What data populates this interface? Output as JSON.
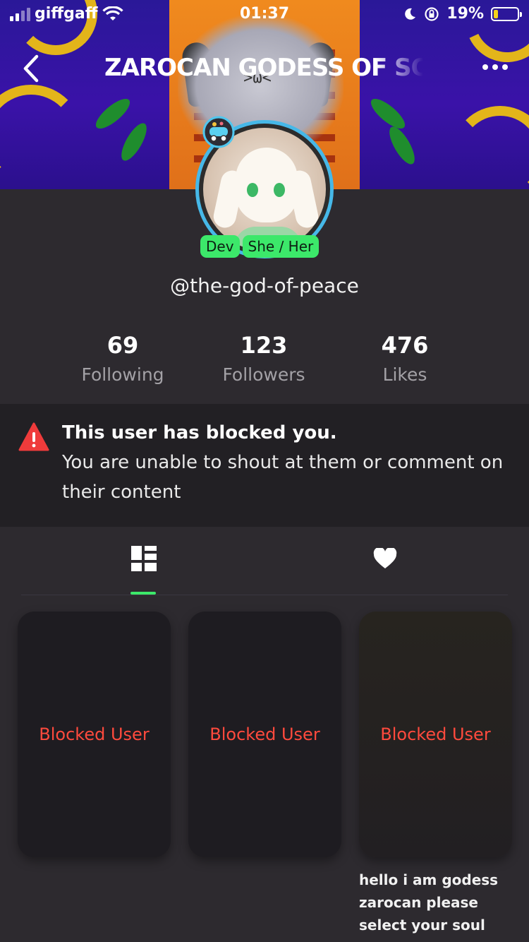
{
  "status_bar": {
    "carrier": "giffgaff",
    "time": "01:37",
    "battery": "19%",
    "battery_level": 0.19
  },
  "nav": {
    "title": "ZAROCAN GODESS OF SOULS"
  },
  "profile": {
    "badges": [
      "Dev",
      "She / Her"
    ],
    "username": "@the-god-of-peace"
  },
  "stats": [
    {
      "value": "69",
      "label": "Following"
    },
    {
      "value": "123",
      "label": "Followers"
    },
    {
      "value": "476",
      "label": "Likes"
    }
  ],
  "notice": {
    "title": "This user has blocked you.",
    "body": "You are unable to shout at them or comment on their content"
  },
  "tabs": [
    {
      "icon": "grid-icon",
      "active": true
    },
    {
      "icon": "heart-icon",
      "active": false
    }
  ],
  "posts": [
    {
      "label": "Blocked User"
    },
    {
      "label": "Blocked User"
    },
    {
      "label": "Blocked User",
      "caption": "hello i am godess zarocan please select your soul"
    }
  ],
  "colors": {
    "accent_green": "#3ce86a",
    "blocked_red": "#ff4a3d",
    "background": "#2d2a2f",
    "notice_background": "#222024"
  }
}
